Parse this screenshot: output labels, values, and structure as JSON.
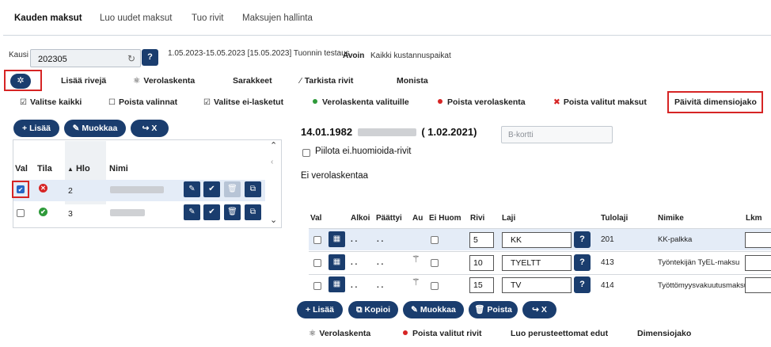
{
  "tabs": [
    "Kauden maksut",
    "Luo uudet maksut",
    "Tuo rivit",
    "Maksujen hallinta"
  ],
  "period": {
    "label": "Kausi",
    "value": "202305",
    "help": "?",
    "description": "1.05.2023-15.05.2023 [15.05.2023] Tuonnin testaus",
    "status": "Avoin",
    "cost_centers": "Kaikki kustannuspaikat"
  },
  "toolbar1": {
    "add_rows": "Lisää rivejä",
    "tax_calc": "Verolaskenta",
    "columns": "Sarakkeet",
    "check_rows": "Tarkista rivit",
    "multi": "Monista"
  },
  "toolbar2": {
    "select_all": "Valitse kaikki",
    "deselect": "Poista valinnat",
    "select_uncalculated": "Valitse ei-lasketut",
    "tax_calc_selected": "Verolaskenta valituille",
    "remove_tax_calc": "Poista verolaskenta",
    "remove_selected_payments": "Poista valitut maksut",
    "update_dimension": "Päivitä dimensiojako"
  },
  "list_buttons": {
    "add": "+ Lisää",
    "edit": "Muokkaa",
    "x": "X"
  },
  "employee_list": {
    "headers": [
      "Val",
      "Tila",
      "Hlo",
      "Nimi"
    ],
    "rows": [
      {
        "selected": true,
        "status": "error",
        "hlo": "2"
      },
      {
        "selected": false,
        "status": "ok",
        "hlo": "3"
      }
    ]
  },
  "employee": {
    "date": "14.01.1982",
    "start": "( 1.02.2021)",
    "card_placeholder": "B-kortti",
    "hide_rows_label": "Piilota ei.huomioida-rivit",
    "tax_status": "Ei verolaskentaa"
  },
  "rows_table": {
    "headers": [
      "Val",
      "Alkoi",
      "Päättyi",
      "Au",
      "Ei Huom",
      "Rivi",
      "Laji",
      "Tulolaji",
      "Nimike",
      "Lkm"
    ],
    "rows": [
      {
        "start": ". .",
        "end": ". .",
        "rivi": "5",
        "laji": "KK",
        "tulolaji": "201",
        "nimike": "KK-palkka"
      },
      {
        "start": ". .",
        "end": ". .",
        "rivi": "10",
        "laji": "TYELTT",
        "tulolaji": "413",
        "nimike": "Työntekijän TyEL-maksu"
      },
      {
        "start": ". .",
        "end": ". .",
        "rivi": "15",
        "laji": "TV",
        "tulolaji": "414",
        "nimike": "Työttömyysvakuutusmaksu"
      }
    ]
  },
  "row_buttons": {
    "add": "+ Lisää",
    "copy": "Kopioi",
    "edit": "Muokkaa",
    "delete": "Poista",
    "x": "X"
  },
  "bottom_actions": {
    "tax_calc": "Verolaskenta",
    "remove_selected_rows": "Poista valitut rivit",
    "create_unfounded": "Luo perusteettomat edut",
    "dimension": "Dimensiojako"
  },
  "colors": {
    "primary": "#1a3d6e",
    "highlight": "#e4ecf7",
    "red": "#d62424",
    "green": "#2e9a3a"
  }
}
